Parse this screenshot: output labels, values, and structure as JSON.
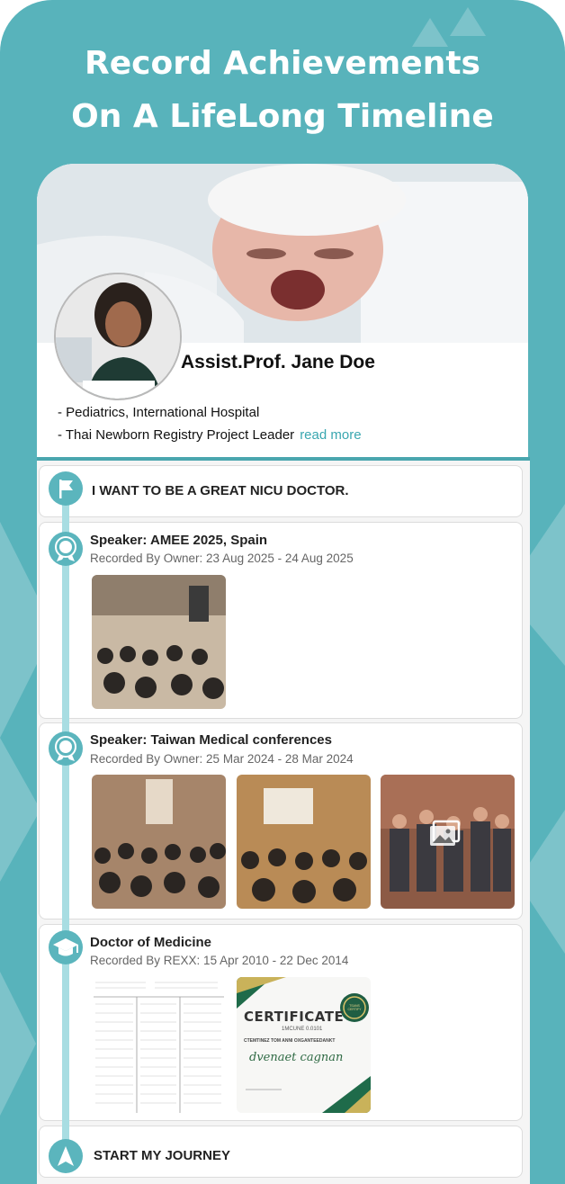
{
  "headline": {
    "line1": "Record Achievements",
    "line2": "On A LifeLong Timeline"
  },
  "profile": {
    "name": "Assist.Prof. Jane Doe",
    "line1": "- Pediatrics, International Hospital",
    "line2": "- Thai Newborn Registry Project Leader",
    "read_more": "read more"
  },
  "goal": {
    "text": "I WANT TO BE A GREAT NICU DOCTOR.",
    "icon": "flag-icon"
  },
  "entries": [
    {
      "title": "Speaker:  AMEE 2025, Spain",
      "subtitle": "Recorded By Owner: 23 Aug 2025 - 24 Aug 2025",
      "icon": "award-icon"
    },
    {
      "title": "Speaker: Taiwan Medical conferences",
      "subtitle": "Recorded By Owner: 25 Mar 2024 - 28 Mar 2024",
      "icon": "award-icon"
    },
    {
      "title": "Doctor of Medicine",
      "subtitle": "Recorded By REXX: 15 Apr 2010 - 22 Dec 2014",
      "icon": "graduation-cap-icon"
    }
  ],
  "certificate": {
    "title": "CERTIFICATE",
    "subtitle": "1MCUNE 0.0101",
    "line": "CTEMTINEZ TOM ANNI OXGANTEEDANKT",
    "signature": "dvenaet cagnan",
    "badge": "TSANS CERTIFY"
  },
  "start": {
    "text": "START MY JOURNEY",
    "icon": "navigation-arrow-icon"
  },
  "colors": {
    "teal": "#58b3bb",
    "accent": "#3aa7b0",
    "line": "#a8dde2"
  }
}
